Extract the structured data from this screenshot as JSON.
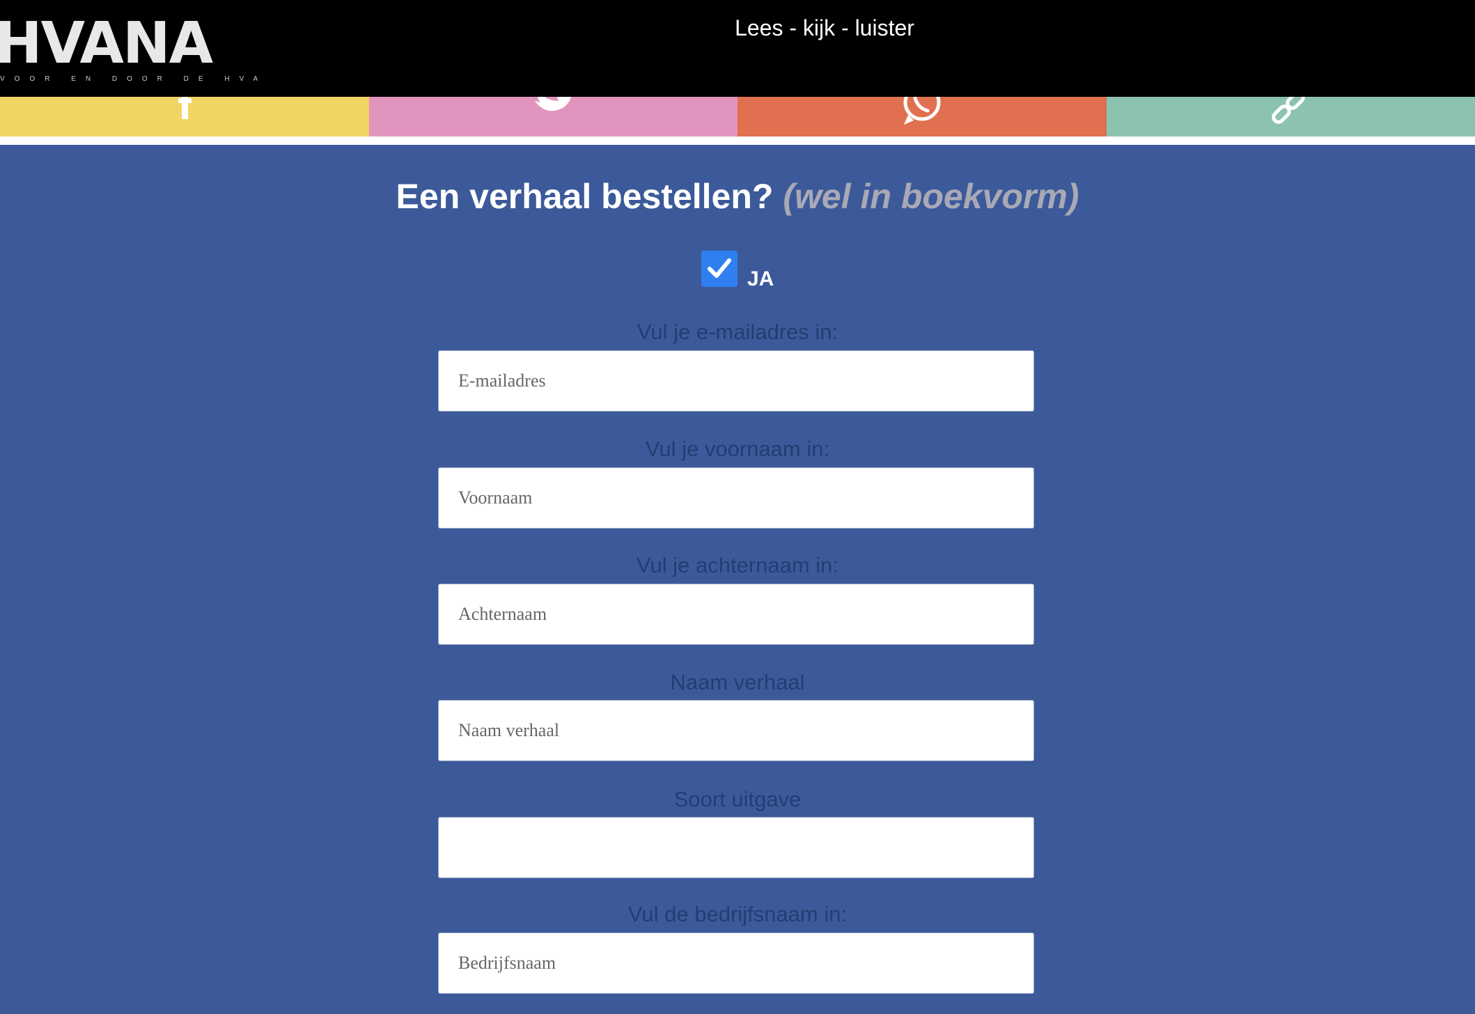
{
  "header": {
    "logo_text": "HVANA",
    "logo_subtitle": "VOOR EN DOOR DE HVA",
    "tagline": "Lees - kijk - luister"
  },
  "share_bar": [
    {
      "name": "facebook-share-button",
      "icon": "facebook-icon",
      "color": "#f2d465"
    },
    {
      "name": "twitter-share-button",
      "icon": "twitter-icon",
      "color": "#e194bd"
    },
    {
      "name": "whatsapp-share-button",
      "icon": "whatsapp-icon",
      "color": "#e07050"
    },
    {
      "name": "link-share-button",
      "icon": "link-icon",
      "color": "#8cc2b0"
    }
  ],
  "form": {
    "title": "Een verhaal bestellen?",
    "title_accent": "(wel in boekvorm)",
    "checkbox_label": "JA",
    "checkbox_checked": true,
    "fields": [
      {
        "label": "Vul je e-mailadres in:",
        "placeholder": "E-mailadres",
        "value": ""
      },
      {
        "label": "Vul je voornaam in:",
        "placeholder": "Voornaam",
        "value": ""
      },
      {
        "label": "Vul je achternaam in:",
        "placeholder": "Achternaam",
        "value": ""
      },
      {
        "label": "Naam verhaal",
        "placeholder": "Naam verhaal",
        "value": ""
      },
      {
        "label": "Soort uitgave",
        "placeholder": "",
        "value": ""
      },
      {
        "label": "Vul de bedrijfsnaam in:",
        "placeholder": "Bedrijfsnaam",
        "value": ""
      }
    ]
  },
  "colors": {
    "header_bg": "#000000",
    "form_bg": "#3c5a9a",
    "label_color": "#243d73",
    "checkbox_color": "#2f7ff1"
  }
}
